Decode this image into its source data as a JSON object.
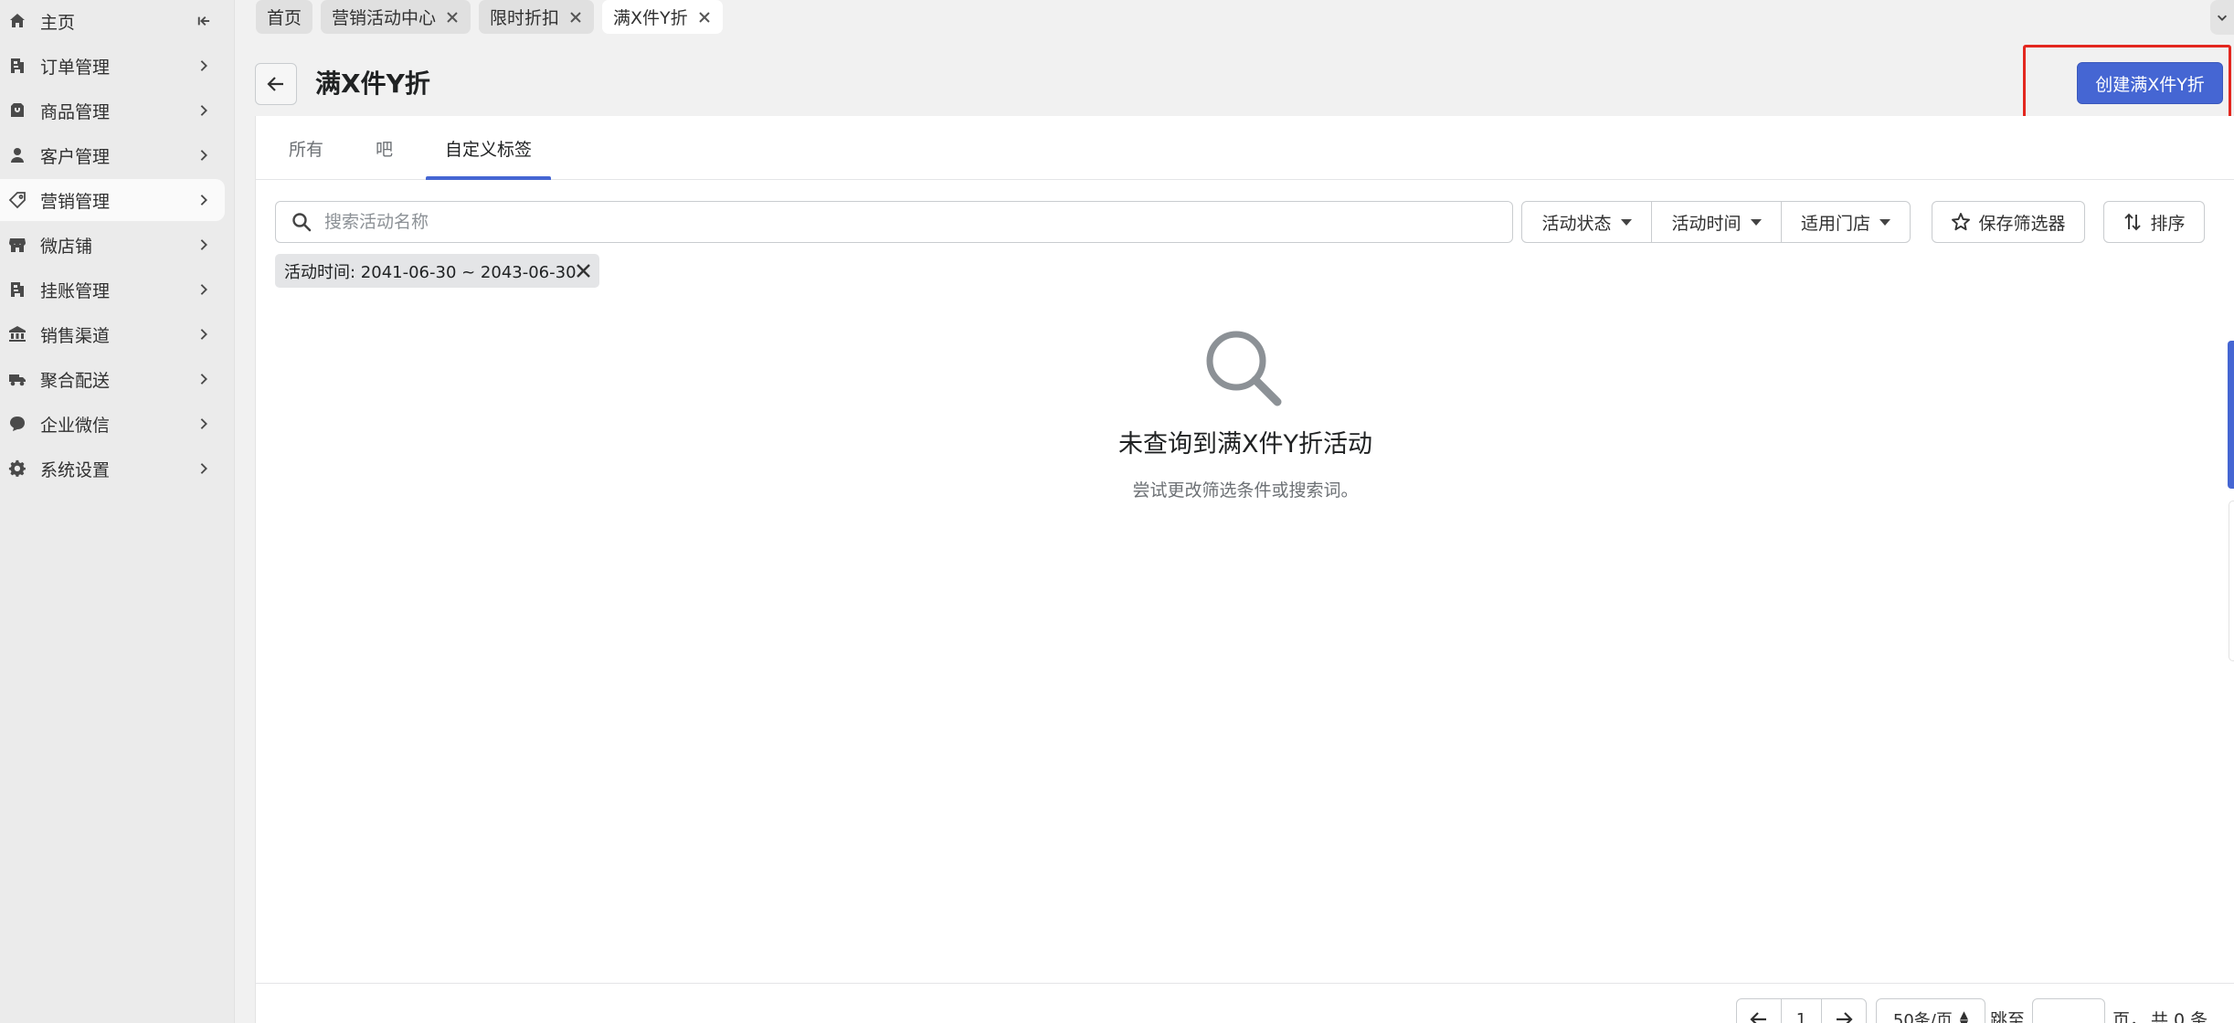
{
  "sidebar": {
    "items": [
      {
        "label": "主页",
        "icon": "home-icon"
      },
      {
        "label": "订单管理",
        "icon": "orders-icon"
      },
      {
        "label": "商品管理",
        "icon": "products-icon"
      },
      {
        "label": "客户管理",
        "icon": "customer-icon"
      },
      {
        "label": "营销管理",
        "icon": "tag-icon"
      },
      {
        "label": "微店铺",
        "icon": "store-icon"
      },
      {
        "label": "挂账管理",
        "icon": "credit-icon"
      },
      {
        "label": "销售渠道",
        "icon": "bank-icon"
      },
      {
        "label": "聚合配送",
        "icon": "delivery-icon"
      },
      {
        "label": "企业微信",
        "icon": "chat-icon"
      },
      {
        "label": "系统设置",
        "icon": "gear-icon"
      }
    ]
  },
  "tabs": [
    {
      "label": "首页"
    },
    {
      "label": "营销活动中心"
    },
    {
      "label": "限时折扣"
    },
    {
      "label": "满X件Y折"
    }
  ],
  "header": {
    "title": "满X件Y折",
    "create_label": "创建满X件Y折"
  },
  "view_tabs": [
    {
      "label": "所有"
    },
    {
      "label": "吧"
    },
    {
      "label": "自定义标签"
    }
  ],
  "search": {
    "placeholder": "搜索活动名称",
    "value": ""
  },
  "filters": {
    "status_label": "活动状态",
    "time_label": "活动时间",
    "store_label": "适用门店",
    "save_label": "保存筛选器",
    "sort_label": "排序"
  },
  "chip": {
    "label": "活动时间: 2041-06-30 ~ 2043-06-30"
  },
  "empty": {
    "title": "未查询到满X件Y折活动",
    "description": "尝试更改筛选条件或搜索词。"
  },
  "pagination": {
    "page": "1",
    "page_size": "50条/页",
    "jump_label": "跳至",
    "page_suffix": "页，",
    "total": "共 0 条"
  },
  "colors": {
    "primary": "#4566d3",
    "highlight": "#e3271f"
  }
}
